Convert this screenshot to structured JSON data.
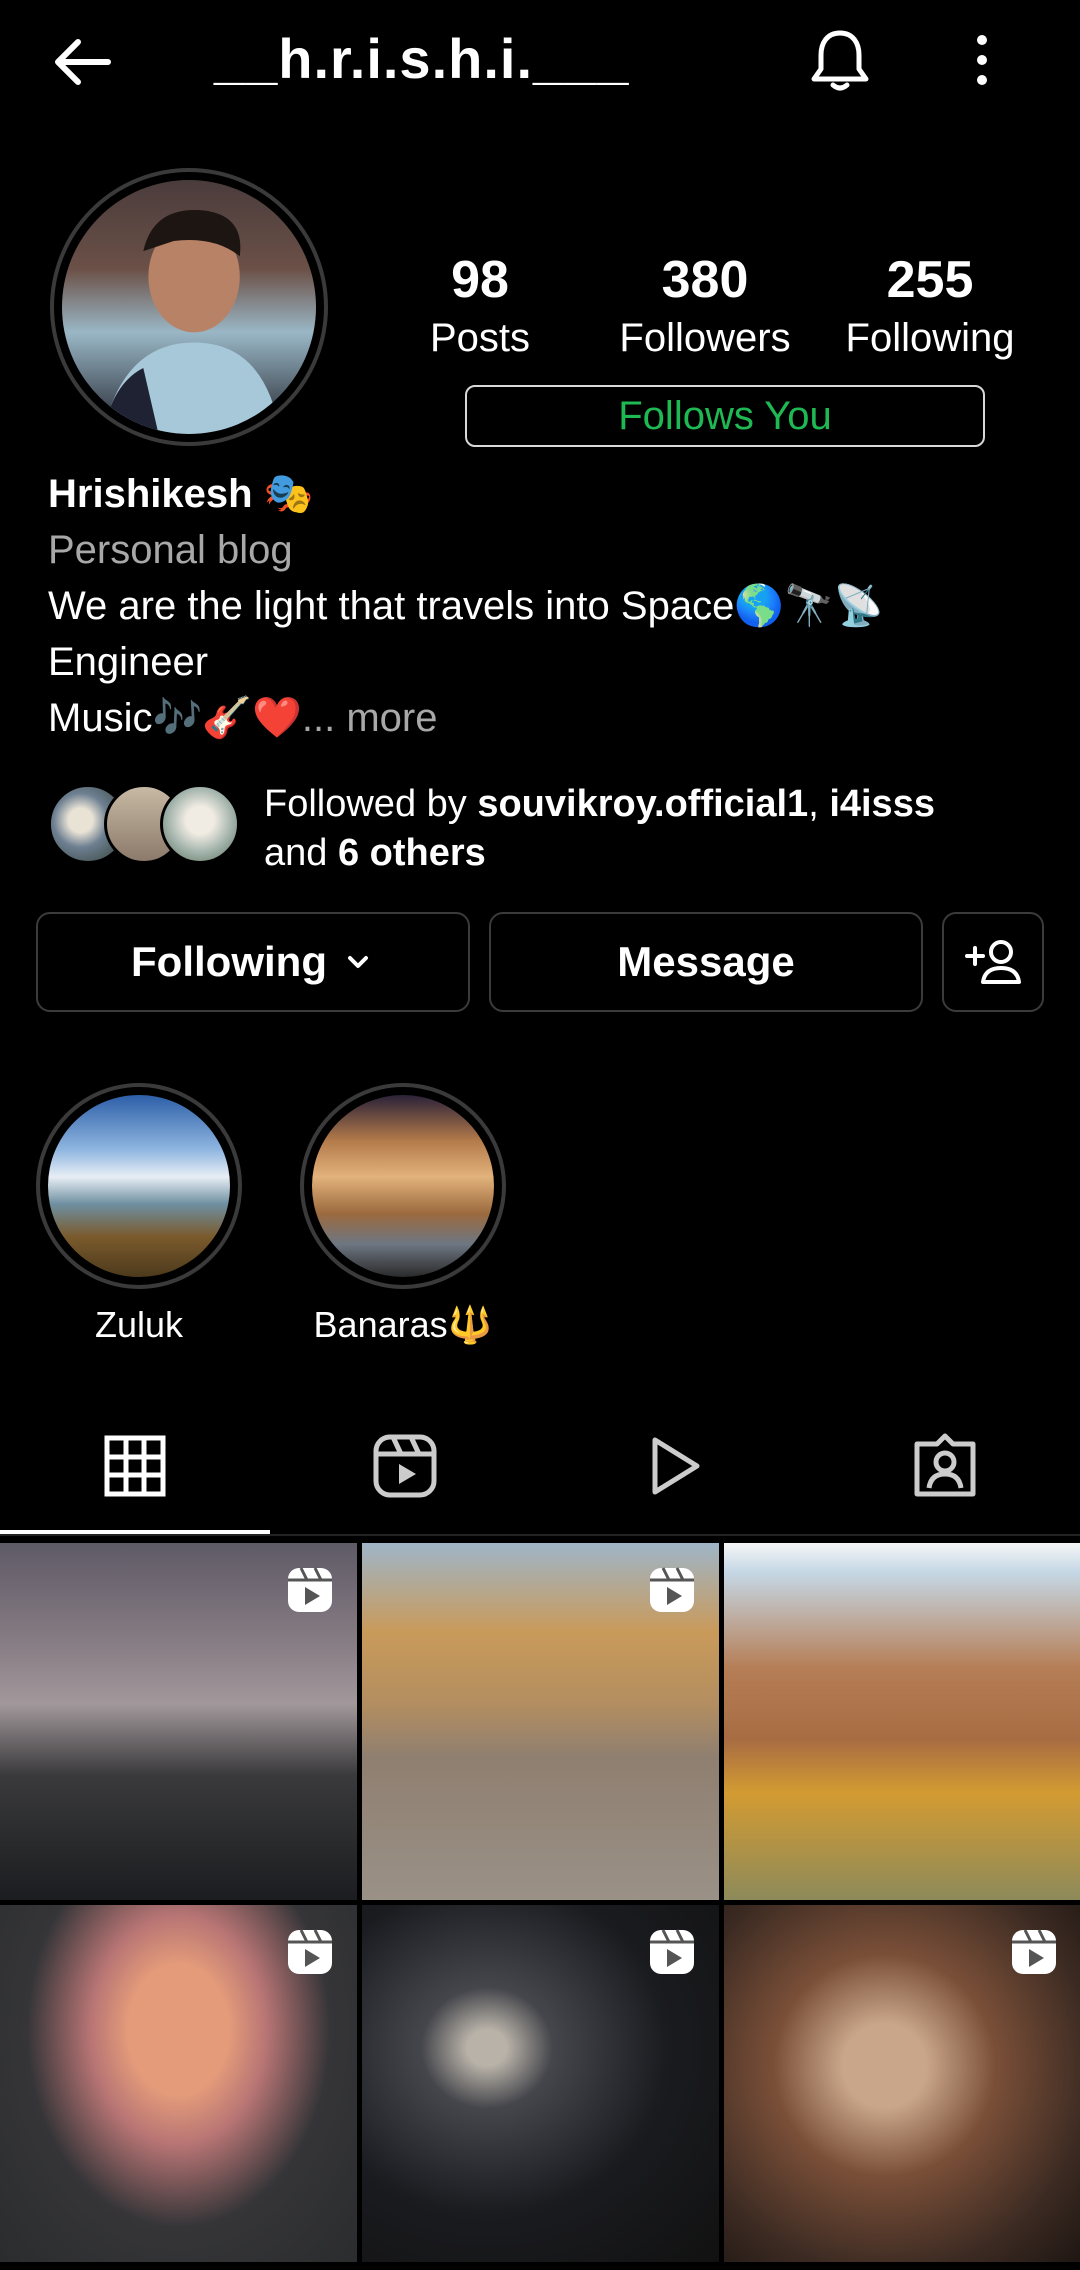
{
  "header": {
    "username": "__h.r.i.s.h.i.___",
    "back_icon": "arrow-left-icon",
    "bell_icon": "bell-icon",
    "more_icon": "more-vertical-icon"
  },
  "profile": {
    "stats": [
      {
        "value": "98",
        "label": "Posts"
      },
      {
        "value": "380",
        "label": "Followers"
      },
      {
        "value": "255",
        "label": "Following"
      }
    ],
    "follows_you": "Follows You",
    "name": "Hrishikesh 🎭",
    "category": "Personal blog",
    "bio_lines": [
      "We are the light that travels into Space🌎🔭📡",
      "Engineer",
      "Music🎶🎸❤️"
    ],
    "more": "... more",
    "followed_by_prefix": "Followed by ",
    "followed_by_names": "souvikroy.official1",
    "followed_by_sep": ", ",
    "followed_by_name2": "i4isss",
    "followed_by_and": "and ",
    "followed_by_others": "6 others"
  },
  "actions": {
    "following_label": "Following",
    "message_label": "Message",
    "add_user_icon": "add-user-icon"
  },
  "highlights": [
    {
      "label": "Zuluk"
    },
    {
      "label": "Banaras🔱"
    }
  ],
  "tabs": [
    {
      "name": "grid",
      "icon": "grid-icon",
      "active": true
    },
    {
      "name": "reels",
      "icon": "reels-icon"
    },
    {
      "name": "videos",
      "icon": "play-icon"
    },
    {
      "name": "tagged",
      "icon": "tagged-person-icon"
    }
  ],
  "posts": [
    {
      "reel": true
    },
    {
      "reel": true
    },
    {
      "reel": false
    },
    {
      "reel": true
    },
    {
      "reel": true
    },
    {
      "reel": true
    }
  ],
  "colors": {
    "background": "#000000",
    "follows_you_text": "#1fb954",
    "muted_text": "#a8a8a8"
  }
}
